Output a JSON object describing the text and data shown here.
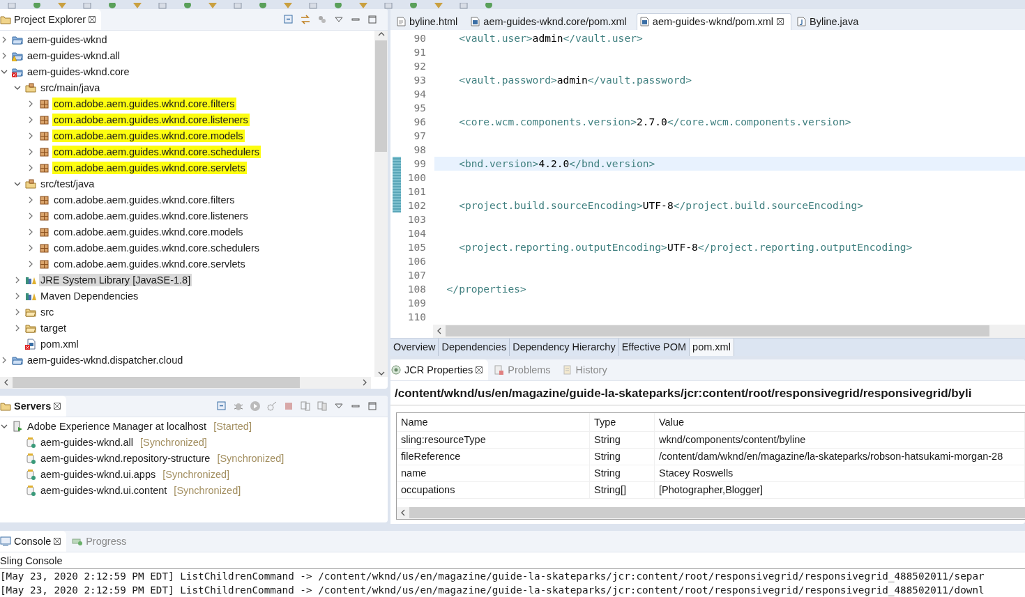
{
  "project_explorer": {
    "title": "Project Explorer",
    "active": false,
    "tree": [
      {
        "label": "aem-guides-wknd",
        "kind": "project",
        "error": false,
        "warning": false,
        "expanded": false,
        "selected": false,
        "marked": false
      },
      {
        "label": "aem-guides-wknd.all",
        "kind": "project",
        "error": false,
        "warning": true,
        "expanded": false,
        "selected": false,
        "marked": false
      },
      {
        "label": "aem-guides-wknd.core",
        "kind": "project",
        "error": true,
        "warning": false,
        "expanded": true,
        "selected": false,
        "marked": false,
        "children": [
          {
            "label": "src/main/java",
            "kind": "source-folder",
            "expanded": true,
            "selected": false,
            "marked": false,
            "children": [
              {
                "label": "com.adobe.aem.guides.wknd.core.filters",
                "kind": "package",
                "expanded": false,
                "selected": false,
                "marked": true
              },
              {
                "label": "com.adobe.aem.guides.wknd.core.listeners",
                "kind": "package",
                "expanded": false,
                "selected": false,
                "marked": true
              },
              {
                "label": "com.adobe.aem.guides.wknd.core.models",
                "kind": "package",
                "expanded": false,
                "selected": false,
                "marked": true
              },
              {
                "label": "com.adobe.aem.guides.wknd.core.schedulers",
                "kind": "package",
                "expanded": false,
                "selected": false,
                "marked": true
              },
              {
                "label": "com.adobe.aem.guides.wknd.core.servlets",
                "kind": "package",
                "expanded": false,
                "selected": false,
                "marked": true
              }
            ]
          },
          {
            "label": "src/test/java",
            "kind": "source-folder",
            "expanded": true,
            "selected": false,
            "marked": false,
            "children": [
              {
                "label": "com.adobe.aem.guides.wknd.core.filters",
                "kind": "package",
                "expanded": false,
                "selected": false,
                "marked": false
              },
              {
                "label": "com.adobe.aem.guides.wknd.core.listeners",
                "kind": "package",
                "expanded": false,
                "selected": false,
                "marked": false
              },
              {
                "label": "com.adobe.aem.guides.wknd.core.models",
                "kind": "package",
                "expanded": false,
                "selected": false,
                "marked": false
              },
              {
                "label": "com.adobe.aem.guides.wknd.core.schedulers",
                "kind": "package",
                "expanded": false,
                "selected": false,
                "marked": false
              },
              {
                "label": "com.adobe.aem.guides.wknd.core.servlets",
                "kind": "package",
                "expanded": false,
                "selected": false,
                "marked": false
              }
            ]
          },
          {
            "label": "JRE System Library [JavaSE-1.8]",
            "kind": "library",
            "expanded": false,
            "selected": true,
            "marked": false
          },
          {
            "label": "Maven Dependencies",
            "kind": "library",
            "expanded": false,
            "selected": false,
            "marked": false
          },
          {
            "label": "src",
            "kind": "folder",
            "expanded": false,
            "selected": false,
            "marked": false
          },
          {
            "label": "target",
            "kind": "folder",
            "expanded": false,
            "selected": false,
            "marked": false
          },
          {
            "label": "pom.xml",
            "kind": "file",
            "error": true,
            "warning": false,
            "selected": false,
            "marked": false
          }
        ]
      },
      {
        "label": "aem-guides-wknd.dispatcher.cloud",
        "kind": "project",
        "error": false,
        "warning": false,
        "expanded": false,
        "selected": false,
        "marked": false
      }
    ]
  },
  "servers": {
    "title": "Servers",
    "active": true,
    "tree": [
      {
        "label": "Adobe Experience Manager at localhost",
        "status": "[Started]",
        "kind": "server",
        "expanded": true,
        "children": [
          {
            "label": "aem-guides-wknd.all",
            "status": "[Synchronized]",
            "kind": "module"
          },
          {
            "label": "aem-guides-wknd.repository-structure",
            "status": "[Synchronized]",
            "kind": "module"
          },
          {
            "label": "aem-guides-wknd.ui.apps",
            "status": "[Synchronized]",
            "kind": "module"
          },
          {
            "label": "aem-guides-wknd.ui.content",
            "status": "[Synchronized]",
            "kind": "module"
          }
        ]
      }
    ]
  },
  "editor": {
    "tabs": [
      {
        "label": "byline.html",
        "kind": "html",
        "selected": false
      },
      {
        "label": "aem-guides-wknd.core/pom.xml",
        "kind": "maven",
        "selected": false
      },
      {
        "label": "aem-guides-wknd/pom.xml",
        "kind": "maven",
        "selected": true
      },
      {
        "label": "Byline.java",
        "kind": "java",
        "selected": false
      }
    ],
    "lines": [
      {
        "number": "90",
        "current": false,
        "changed": false,
        "code": [
          {
            "kind": "tag",
            "text": "    <vault.user>"
          },
          {
            "kind": "value",
            "text": "admin"
          },
          {
            "kind": "tag",
            "text": "</vault.user>"
          }
        ]
      },
      {
        "number": "91",
        "current": false,
        "changed": false
      },
      {
        "number": "92",
        "current": false,
        "changed": false
      },
      {
        "number": "93",
        "current": false,
        "changed": false,
        "code": [
          {
            "kind": "tag",
            "text": "    <vault.password>"
          },
          {
            "kind": "value",
            "text": "admin"
          },
          {
            "kind": "tag",
            "text": "</vault.password>"
          }
        ]
      },
      {
        "number": "94",
        "current": false,
        "changed": false
      },
      {
        "number": "95",
        "current": false,
        "changed": false
      },
      {
        "number": "96",
        "current": false,
        "changed": false,
        "code": [
          {
            "kind": "tag",
            "text": "    <core.wcm.components.version>"
          },
          {
            "kind": "value",
            "text": "2.7.0"
          },
          {
            "kind": "tag",
            "text": "</core.wcm.components.version>"
          }
        ]
      },
      {
        "number": "97",
        "current": false,
        "changed": false
      },
      {
        "number": "98",
        "current": false,
        "changed": false
      },
      {
        "number": "99",
        "current": true,
        "changed": true,
        "code": [
          {
            "kind": "tag",
            "text": "    <bnd.version>"
          },
          {
            "kind": "value",
            "text": "4.2.0"
          },
          {
            "kind": "tag",
            "text": "</bnd.version>"
          }
        ]
      },
      {
        "number": "100",
        "current": false,
        "changed": true
      },
      {
        "number": "101",
        "current": false,
        "changed": true
      },
      {
        "number": "102",
        "current": false,
        "changed": true,
        "code": [
          {
            "kind": "tag",
            "text": "    <project.build.sourceEncoding>"
          },
          {
            "kind": "value",
            "text": "UTF-8"
          },
          {
            "kind": "tag",
            "text": "</project.build.sourceEncoding>"
          }
        ]
      },
      {
        "number": "103",
        "current": false,
        "changed": false
      },
      {
        "number": "104",
        "current": false,
        "changed": false
      },
      {
        "number": "105",
        "current": false,
        "changed": false,
        "code": [
          {
            "kind": "tag",
            "text": "    <project.reporting.outputEncoding>"
          },
          {
            "kind": "value",
            "text": "UTF-8"
          },
          {
            "kind": "tag",
            "text": "</project.reporting.outputEncoding>"
          }
        ]
      },
      {
        "number": "106",
        "current": false,
        "changed": false
      },
      {
        "number": "107",
        "current": false,
        "changed": false
      },
      {
        "number": "108",
        "current": false,
        "changed": false,
        "code": [
          {
            "kind": "tag",
            "text": "  </properties>"
          }
        ]
      },
      {
        "number": "109",
        "current": false,
        "changed": false
      },
      {
        "number": "110",
        "current": false,
        "changed": false
      }
    ],
    "page_tabs": [
      {
        "label": "Overview",
        "selected": false
      },
      {
        "label": "Dependencies",
        "selected": false
      },
      {
        "label": "Dependency Hierarchy",
        "selected": false
      },
      {
        "label": "Effective POM",
        "selected": false
      },
      {
        "label": "pom.xml",
        "selected": true
      }
    ]
  },
  "properties": {
    "tabs": [
      {
        "label": "JCR Properties",
        "kind": "jcr",
        "selected": true
      },
      {
        "label": "Problems",
        "kind": "problems",
        "selected": false
      },
      {
        "label": "History",
        "kind": "history",
        "selected": false
      }
    ],
    "path": "/content/wknd/us/en/magazine/guide-la-skateparks/jcr:content/root/responsivegrid/responsivegrid/byli",
    "table": {
      "columns": [
        "Name",
        "Type",
        "Value"
      ],
      "rows": [
        [
          "sling:resourceType",
          "String",
          "wknd/components/content/byline"
        ],
        [
          "fileReference",
          "String",
          "/content/dam/wknd/en/magazine/la-skateparks/robson-hatsukami-morgan-28"
        ],
        [
          "name",
          "String",
          "Stacey Roswells"
        ],
        [
          "occupations",
          "String[]",
          "[Photographer,Blogger]"
        ]
      ]
    }
  },
  "console": {
    "tabs": [
      {
        "label": "Console",
        "kind": "console",
        "selected": true
      },
      {
        "label": "Progress",
        "kind": "progress",
        "selected": false
      }
    ],
    "name": "Sling Console",
    "lines": [
      "[May 23, 2020 2:12:59 PM EDT] ListChildrenCommand -> /content/wknd/us/en/magazine/guide-la-skateparks/jcr:content/root/responsivegrid/responsivegrid_488502011/separ",
      "[May 23, 2020 2:12:59 PM EDT] ListChildrenCommand -> /content/wknd/us/en/magazine/guide-la-skateparks/jcr:content/root/responsivegrid/responsivegrid_488502011/downl"
    ]
  }
}
